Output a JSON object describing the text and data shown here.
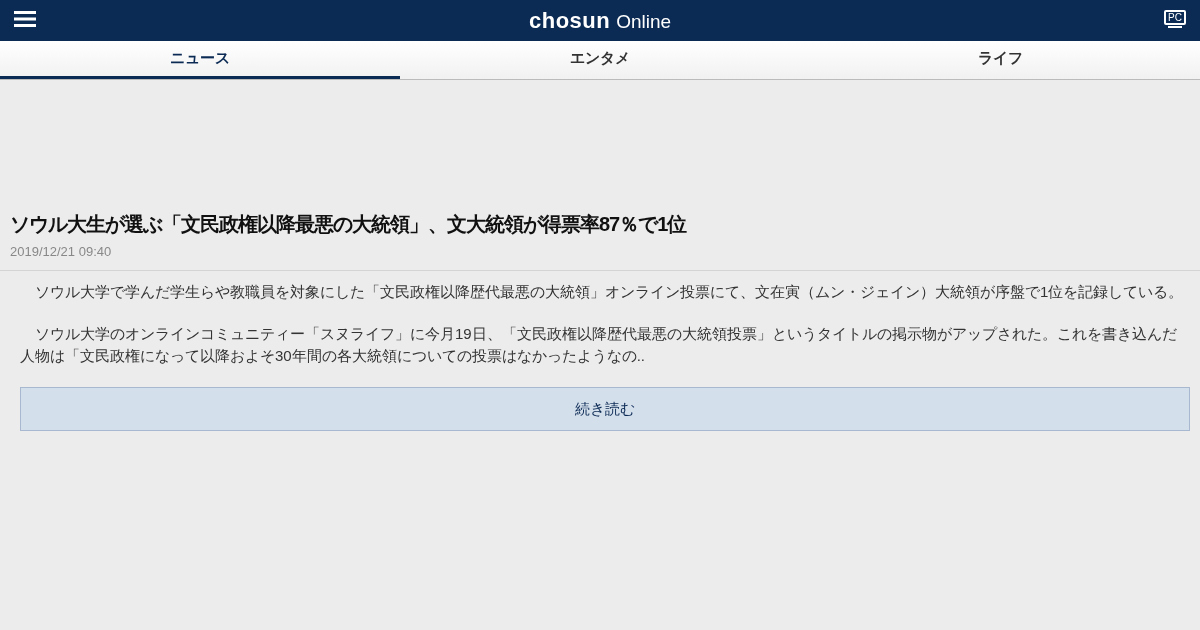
{
  "header": {
    "logo_bold": "chosun",
    "logo_light": "Online",
    "pc_label": "PC"
  },
  "tabs": [
    {
      "label": "ニュース",
      "selected": true
    },
    {
      "label": "エンタメ",
      "selected": false
    },
    {
      "label": "ライフ",
      "selected": false
    }
  ],
  "article": {
    "title": "ソウル大生が選ぶ「文民政権以降最悪の大統領」、文大統領が得票率87％で1位",
    "date": "2019/12/21 09:40",
    "paragraphs": [
      "ソウル大学で学んだ学生らや教職員を対象にした「文民政権以降歴代最悪の大統領」オンライン投票にて、文在寅（ムン・ジェイン）大統領が序盤で1位を記録している。",
      "ソウル大学のオンラインコミュニティー「スヌライフ」に今月19日、「文民政権以降歴代最悪の大統領投票」というタイトルの掲示物がアップされた。これを書き込んだ人物は「文民政権になって以降およそ30年間の各大統領についての投票はなかったようなの.."
    ],
    "more_button": "続き読む"
  }
}
